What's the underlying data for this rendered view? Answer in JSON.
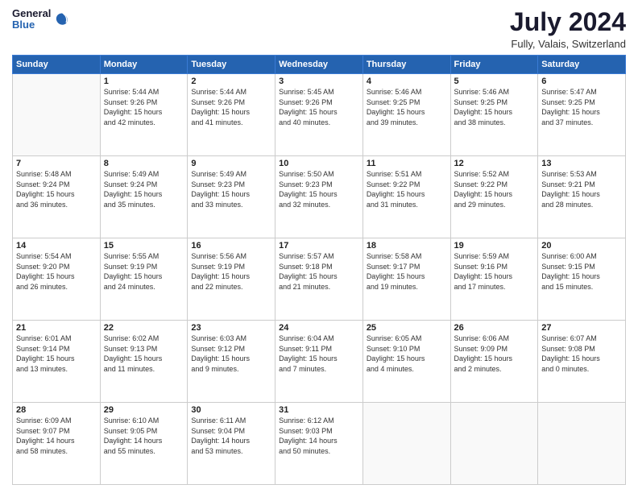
{
  "header": {
    "logo_line1": "General",
    "logo_line2": "Blue",
    "month_year": "July 2024",
    "location": "Fully, Valais, Switzerland"
  },
  "weekdays": [
    "Sunday",
    "Monday",
    "Tuesday",
    "Wednesday",
    "Thursday",
    "Friday",
    "Saturday"
  ],
  "weeks": [
    [
      {
        "day": "",
        "info": ""
      },
      {
        "day": "1",
        "info": "Sunrise: 5:44 AM\nSunset: 9:26 PM\nDaylight: 15 hours\nand 42 minutes."
      },
      {
        "day": "2",
        "info": "Sunrise: 5:44 AM\nSunset: 9:26 PM\nDaylight: 15 hours\nand 41 minutes."
      },
      {
        "day": "3",
        "info": "Sunrise: 5:45 AM\nSunset: 9:26 PM\nDaylight: 15 hours\nand 40 minutes."
      },
      {
        "day": "4",
        "info": "Sunrise: 5:46 AM\nSunset: 9:25 PM\nDaylight: 15 hours\nand 39 minutes."
      },
      {
        "day": "5",
        "info": "Sunrise: 5:46 AM\nSunset: 9:25 PM\nDaylight: 15 hours\nand 38 minutes."
      },
      {
        "day": "6",
        "info": "Sunrise: 5:47 AM\nSunset: 9:25 PM\nDaylight: 15 hours\nand 37 minutes."
      }
    ],
    [
      {
        "day": "7",
        "info": "Sunrise: 5:48 AM\nSunset: 9:24 PM\nDaylight: 15 hours\nand 36 minutes."
      },
      {
        "day": "8",
        "info": "Sunrise: 5:49 AM\nSunset: 9:24 PM\nDaylight: 15 hours\nand 35 minutes."
      },
      {
        "day": "9",
        "info": "Sunrise: 5:49 AM\nSunset: 9:23 PM\nDaylight: 15 hours\nand 33 minutes."
      },
      {
        "day": "10",
        "info": "Sunrise: 5:50 AM\nSunset: 9:23 PM\nDaylight: 15 hours\nand 32 minutes."
      },
      {
        "day": "11",
        "info": "Sunrise: 5:51 AM\nSunset: 9:22 PM\nDaylight: 15 hours\nand 31 minutes."
      },
      {
        "day": "12",
        "info": "Sunrise: 5:52 AM\nSunset: 9:22 PM\nDaylight: 15 hours\nand 29 minutes."
      },
      {
        "day": "13",
        "info": "Sunrise: 5:53 AM\nSunset: 9:21 PM\nDaylight: 15 hours\nand 28 minutes."
      }
    ],
    [
      {
        "day": "14",
        "info": "Sunrise: 5:54 AM\nSunset: 9:20 PM\nDaylight: 15 hours\nand 26 minutes."
      },
      {
        "day": "15",
        "info": "Sunrise: 5:55 AM\nSunset: 9:19 PM\nDaylight: 15 hours\nand 24 minutes."
      },
      {
        "day": "16",
        "info": "Sunrise: 5:56 AM\nSunset: 9:19 PM\nDaylight: 15 hours\nand 22 minutes."
      },
      {
        "day": "17",
        "info": "Sunrise: 5:57 AM\nSunset: 9:18 PM\nDaylight: 15 hours\nand 21 minutes."
      },
      {
        "day": "18",
        "info": "Sunrise: 5:58 AM\nSunset: 9:17 PM\nDaylight: 15 hours\nand 19 minutes."
      },
      {
        "day": "19",
        "info": "Sunrise: 5:59 AM\nSunset: 9:16 PM\nDaylight: 15 hours\nand 17 minutes."
      },
      {
        "day": "20",
        "info": "Sunrise: 6:00 AM\nSunset: 9:15 PM\nDaylight: 15 hours\nand 15 minutes."
      }
    ],
    [
      {
        "day": "21",
        "info": "Sunrise: 6:01 AM\nSunset: 9:14 PM\nDaylight: 15 hours\nand 13 minutes."
      },
      {
        "day": "22",
        "info": "Sunrise: 6:02 AM\nSunset: 9:13 PM\nDaylight: 15 hours\nand 11 minutes."
      },
      {
        "day": "23",
        "info": "Sunrise: 6:03 AM\nSunset: 9:12 PM\nDaylight: 15 hours\nand 9 minutes."
      },
      {
        "day": "24",
        "info": "Sunrise: 6:04 AM\nSunset: 9:11 PM\nDaylight: 15 hours\nand 7 minutes."
      },
      {
        "day": "25",
        "info": "Sunrise: 6:05 AM\nSunset: 9:10 PM\nDaylight: 15 hours\nand 4 minutes."
      },
      {
        "day": "26",
        "info": "Sunrise: 6:06 AM\nSunset: 9:09 PM\nDaylight: 15 hours\nand 2 minutes."
      },
      {
        "day": "27",
        "info": "Sunrise: 6:07 AM\nSunset: 9:08 PM\nDaylight: 15 hours\nand 0 minutes."
      }
    ],
    [
      {
        "day": "28",
        "info": "Sunrise: 6:09 AM\nSunset: 9:07 PM\nDaylight: 14 hours\nand 58 minutes."
      },
      {
        "day": "29",
        "info": "Sunrise: 6:10 AM\nSunset: 9:05 PM\nDaylight: 14 hours\nand 55 minutes."
      },
      {
        "day": "30",
        "info": "Sunrise: 6:11 AM\nSunset: 9:04 PM\nDaylight: 14 hours\nand 53 minutes."
      },
      {
        "day": "31",
        "info": "Sunrise: 6:12 AM\nSunset: 9:03 PM\nDaylight: 14 hours\nand 50 minutes."
      },
      {
        "day": "",
        "info": ""
      },
      {
        "day": "",
        "info": ""
      },
      {
        "day": "",
        "info": ""
      }
    ]
  ]
}
